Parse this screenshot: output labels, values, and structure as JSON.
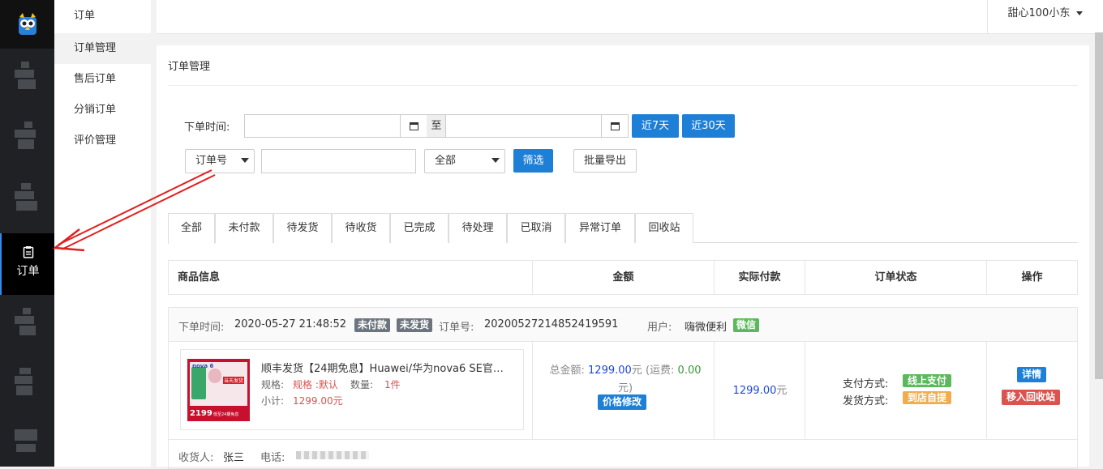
{
  "colors": {
    "accent": "#1e7fd6",
    "nav_bg": "#1f2125",
    "badge_gray": "#6c757d",
    "badge_green": "#5cb85c",
    "badge_orange": "#f0ad4e",
    "badge_red": "#d9534f"
  },
  "rail": {
    "active_label": "订单",
    "active_icon": "clipboard-icon"
  },
  "subnav": {
    "header": "订单",
    "items": [
      {
        "label": "订单管理"
      },
      {
        "label": "售后订单"
      },
      {
        "label": "分销订单"
      },
      {
        "label": "评价管理"
      }
    ]
  },
  "topbar": {
    "user": "甜心100小东"
  },
  "page": {
    "title": "订单管理"
  },
  "filter": {
    "time_label": "下单时间:",
    "to_label": "至",
    "btn_7": "近7天",
    "btn_30": "近30天",
    "order_no_select": "订单号",
    "status_select": "全部",
    "filter_btn": "筛选",
    "export_btn": "批量导出"
  },
  "tabs": [
    "全部",
    "未付款",
    "待发货",
    "待收货",
    "已完成",
    "待处理",
    "已取消",
    "异常订单",
    "回收站"
  ],
  "table_headers": [
    "商品信息",
    "金额",
    "实际付款",
    "订单状态",
    "操作"
  ],
  "order": {
    "time_label": "下单时间:",
    "time": "2020-05-27 21:48:52",
    "badge_unpaid": "未付款",
    "badge_unshipped": "未发货",
    "order_no_label": "订单号:",
    "order_no": "20200527214852419591",
    "user_label": "用户:",
    "user": "嗨微便利",
    "user_badge": "微信",
    "product_title": "顺丰发货【24期免息】Huawei/华为nova6 SE官…",
    "spec_label": "规格:",
    "spec": "规格 :默认",
    "qty_label": "数量:",
    "qty": "1件",
    "subtotal_label": "小计:",
    "subtotal": "1299.00元",
    "total_label": "总金额:",
    "total": "1299.00",
    "yuan": "元",
    "freight_label": "(运费:",
    "freight": "0.00",
    "freight_end": "元)",
    "price_edit": "价格修改",
    "actual_pay": "1299.00",
    "actual_yuan": "元",
    "pay_label": "支付方式:",
    "pay": "线上支付",
    "ship_label": "发货方式:",
    "ship": "到店自提",
    "detail_btn": "详情",
    "recycle_btn": "移入回收站",
    "receiver_label": "收货人:",
    "receiver": "张三",
    "phone_label": "电话:",
    "thumb_texts": [
      "nova 6",
      "当天发货",
      "2199",
      "低至24期免息"
    ]
  }
}
